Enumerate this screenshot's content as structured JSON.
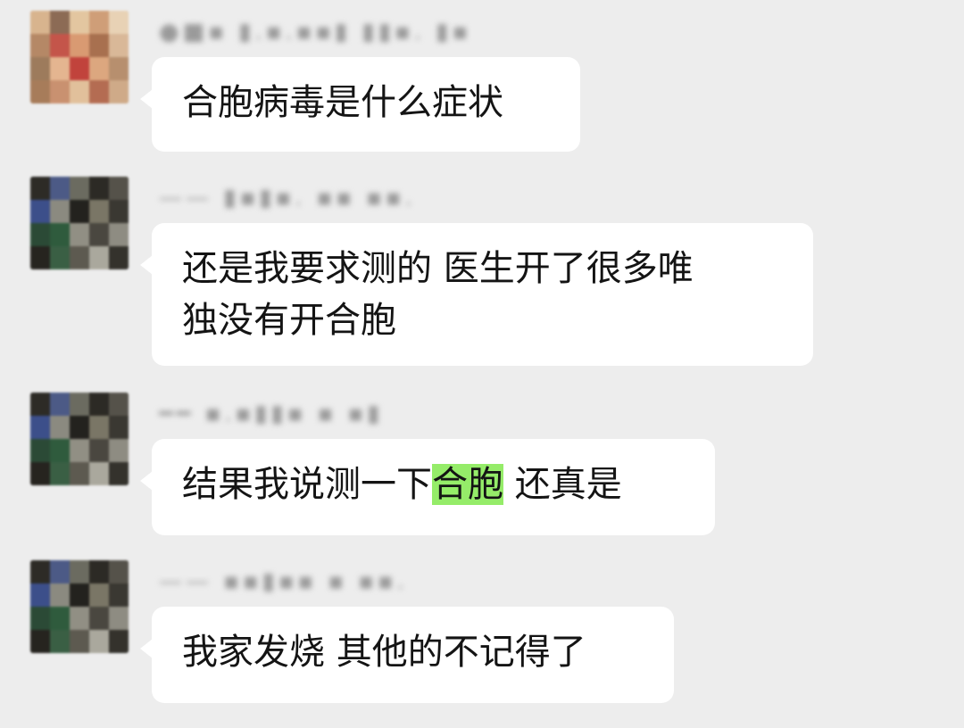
{
  "chat": {
    "messages": [
      {
        "sender": "●■▪ ▮.▪.▪▪▮ ▮▮▪. ▮▪",
        "text": "合胞病毒是什么症状"
      },
      {
        "sender": "—— ▮▪▮▪. ▪▪ ▪▪.",
        "line1": "还是我要求测的  医生开了很多唯",
        "line2": "独没有开合胞"
      },
      {
        "sender": "━━ ▪.▪▮▮▪ ▪ ▪▮",
        "text_before": "结果我说测一下",
        "text_highlight": "合胞",
        "text_after": " 还真是"
      },
      {
        "sender": "—— ▪▪▮▪▪ ▪ ▪▪.",
        "text": "我家发烧 其他的不记得了"
      }
    ]
  },
  "colors": {
    "background": "#ededed",
    "bubble": "#ffffff",
    "highlight": "#95ec69",
    "text": "#141414"
  }
}
